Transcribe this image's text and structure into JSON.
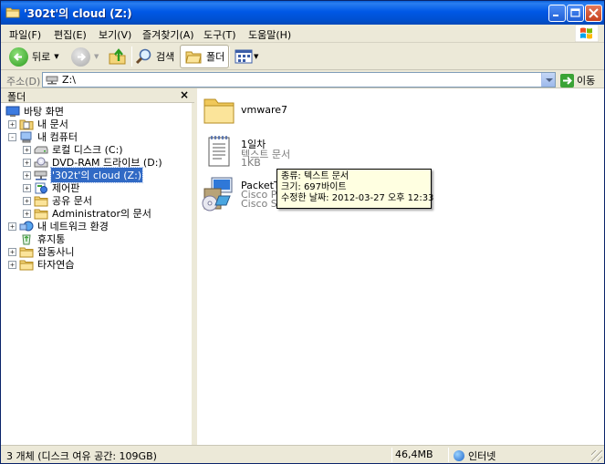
{
  "window": {
    "title": "'302t'의 cloud (Z:)"
  },
  "menu": {
    "items": [
      "파일(F)",
      "편집(E)",
      "보기(V)",
      "즐겨찾기(A)",
      "도구(T)",
      "도움말(H)"
    ]
  },
  "toolbar": {
    "back_label": "뒤로",
    "search_label": "검색",
    "folders_label": "폴더"
  },
  "address": {
    "label": "주소(D)",
    "value": "Z:\\",
    "go_label": "이동"
  },
  "folder_pane": {
    "title": "폴더",
    "close_glyph": "×",
    "tree": [
      {
        "label": "바탕 화면",
        "icon": "desktop-icon",
        "expander": ""
      },
      {
        "label": "내 문서",
        "icon": "my-documents-icon",
        "expander": "+"
      },
      {
        "label": "내 컴퓨터",
        "icon": "my-computer-icon",
        "expander": "-"
      },
      {
        "label": "로컬 디스크 (C:)",
        "icon": "local-disk-icon",
        "expander": "+"
      },
      {
        "label": "DVD-RAM 드라이브 (D:)",
        "icon": "dvd-drive-icon",
        "expander": "+"
      },
      {
        "label": "'302t'의 cloud (Z:)",
        "icon": "network-drive-icon",
        "expander": "+"
      },
      {
        "label": "제어판",
        "icon": "control-panel-icon",
        "expander": "+"
      },
      {
        "label": "공유 문서",
        "icon": "shared-folder-icon",
        "expander": "+"
      },
      {
        "label": "Administrator의 문서",
        "icon": "folder-icon",
        "expander": "+"
      },
      {
        "label": "내 네트워크 환경",
        "icon": "network-places-icon",
        "expander": "+"
      },
      {
        "label": "휴지통",
        "icon": "recycle-bin-icon",
        "expander": ""
      },
      {
        "label": "잡동사니",
        "icon": "folder-icon",
        "expander": "+"
      },
      {
        "label": "타자연습",
        "icon": "folder-icon",
        "expander": "+"
      }
    ]
  },
  "files": [
    {
      "name": "vmware7",
      "icon": "folder-icon"
    },
    {
      "name": "1일차",
      "type": "텍스트 문서",
      "size": "1KB",
      "icon": "text-document-icon"
    },
    {
      "name": "PacketT",
      "line2": "Cisco P",
      "line3": "Cisco S",
      "icon": "installer-icon"
    }
  ],
  "tooltip": {
    "type_line": "종류: 텍스트 문서",
    "size_line": "크기: 697바이트",
    "date_line": "수정한 날짜: 2012-03-27 오후 12:33"
  },
  "status": {
    "objects": "3 개체 (디스크 여유 공간: 109GB)",
    "size": "46,4MB",
    "zone": "인터넷"
  }
}
